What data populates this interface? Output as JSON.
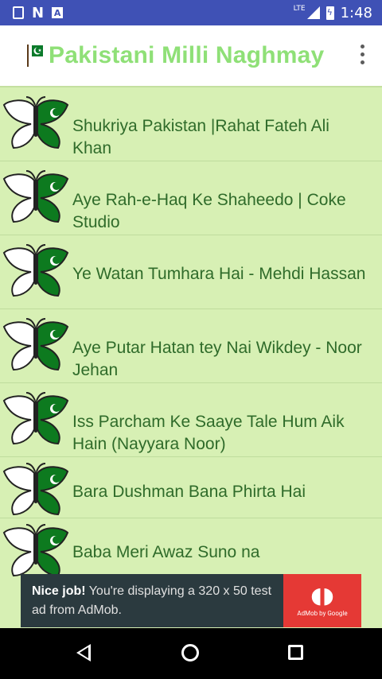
{
  "status_bar": {
    "network": "LTE",
    "time": "1:48"
  },
  "app_bar": {
    "title": "Pakistani Milli Naghmay"
  },
  "songs": [
    {
      "title": "Shukriya Pakistan |Rahat Fateh Ali Khan"
    },
    {
      "title": "Aye Rah-e-Haq Ke Shaheedo | Coke Studio"
    },
    {
      "title": "Ye Watan Tumhara Hai - Mehdi Hassan"
    },
    {
      "title": "Aye Putar Hatan tey Nai Wikdey - Noor Jehan"
    },
    {
      "title": "Iss Parcham Ke Saaye Tale Hum Aik Hain (Nayyara Noor)"
    },
    {
      "title": "Bara Dushman Bana Phirta Hai"
    },
    {
      "title": "Baba Meri Awaz Suno na"
    }
  ],
  "ad": {
    "headline": "Nice job!",
    "body": " You're displaying a 320 x 50 test ad from AdMob.",
    "brand": "AdMob by Google"
  },
  "colors": {
    "status_bar": "#3f51b5",
    "title_green": "#8fe077",
    "list_background": "#d7f0b4",
    "item_text": "#2f6b2a"
  }
}
